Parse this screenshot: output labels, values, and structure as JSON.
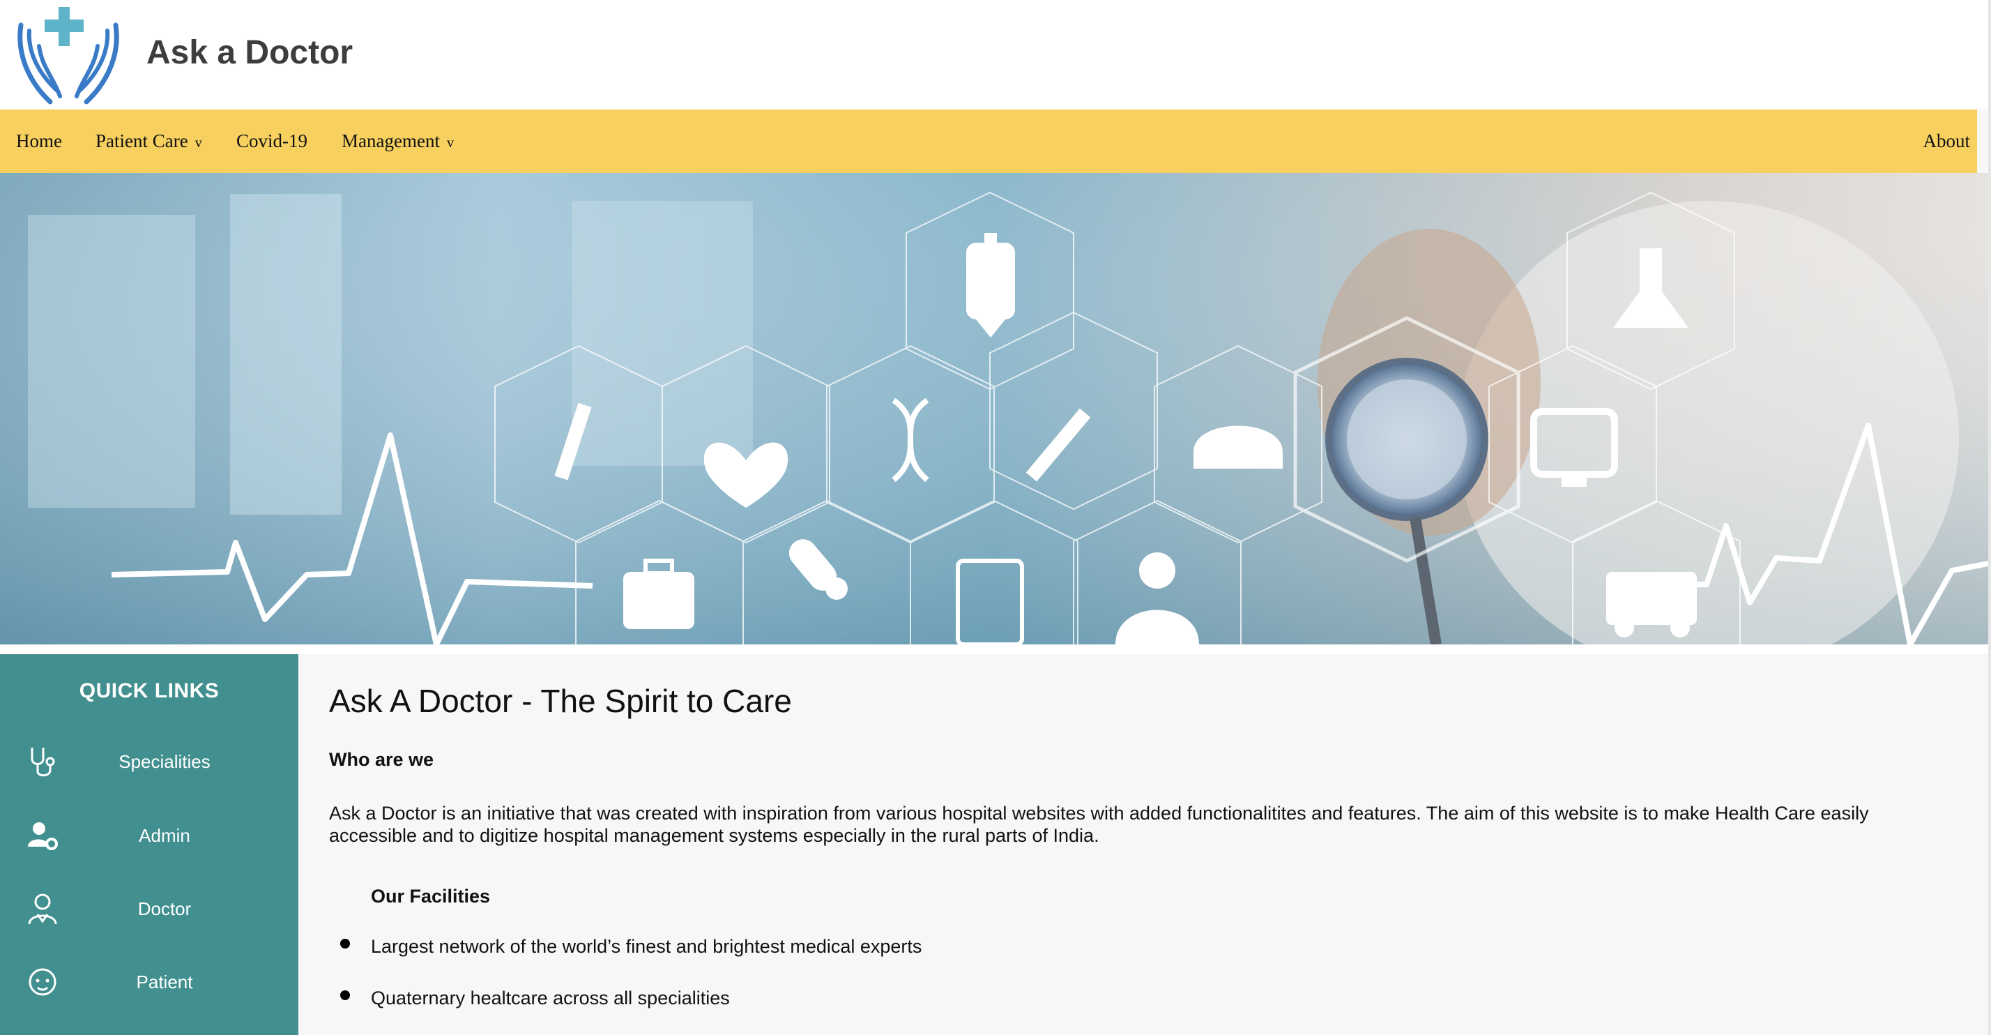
{
  "header": {
    "site_title": "Ask a Doctor",
    "logo_icon": "hands-medical-cross-icon"
  },
  "nav": {
    "items": [
      {
        "label": "Home",
        "dropdown": false
      },
      {
        "label": "Patient Care",
        "dropdown": true
      },
      {
        "label": "Covid-19",
        "dropdown": false
      },
      {
        "label": "Management",
        "dropdown": true
      }
    ],
    "right_item": "About",
    "caret": "v"
  },
  "sidebar": {
    "title": "QUICK LINKS",
    "items": [
      {
        "label": "Specialities",
        "icon": "stethoscope-icon"
      },
      {
        "label": "Admin",
        "icon": "user-gear-icon"
      },
      {
        "label": "Doctor",
        "icon": "doctor-icon"
      },
      {
        "label": "Patient",
        "icon": "patient-face-icon"
      }
    ]
  },
  "main": {
    "heading": "Ask A Doctor - The Spirit to Care",
    "who_heading": "Who are we",
    "intro": "Ask a Doctor is an initiative that was created with inspiration from various hospital websites with added functionalitites and features. The aim of this website is to make Health Care easily accessible and to digitize hospital management systems especially in the rural parts of India.",
    "facilities_heading": "Our Facilities",
    "facilities": [
      "Largest network of the world’s finest and brightest medical experts",
      "Quaternary healtcare across all specialities"
    ]
  },
  "colors": {
    "nav_bg": "#f7d060",
    "sidebar_bg": "#418f8e",
    "logo_blue": "#3a7bc8",
    "logo_cross": "#5fb3c9",
    "page_bg": "#f7f7f7"
  }
}
